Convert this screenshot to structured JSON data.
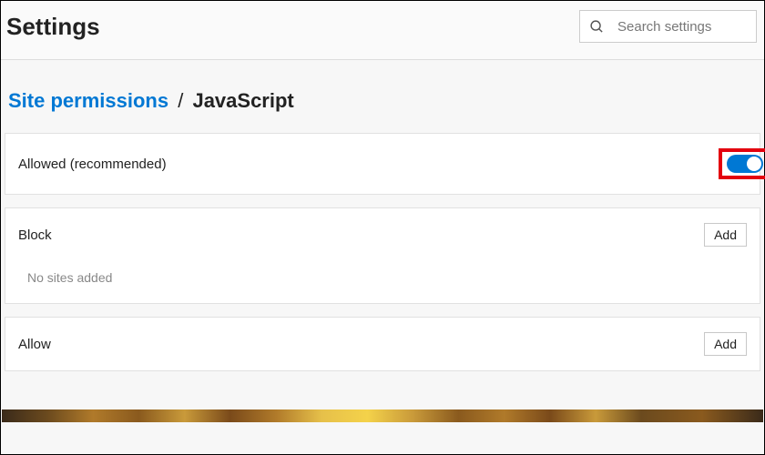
{
  "header": {
    "title": "Settings",
    "search_placeholder": "Search settings"
  },
  "breadcrumb": {
    "parent": "Site permissions",
    "separator": "/",
    "current": "JavaScript"
  },
  "main": {
    "allowed_label": "Allowed (recommended)",
    "allowed_toggle_on": true
  },
  "block": {
    "title": "Block",
    "add_label": "Add",
    "empty_text": "No sites added"
  },
  "allow": {
    "title": "Allow",
    "add_label": "Add"
  }
}
